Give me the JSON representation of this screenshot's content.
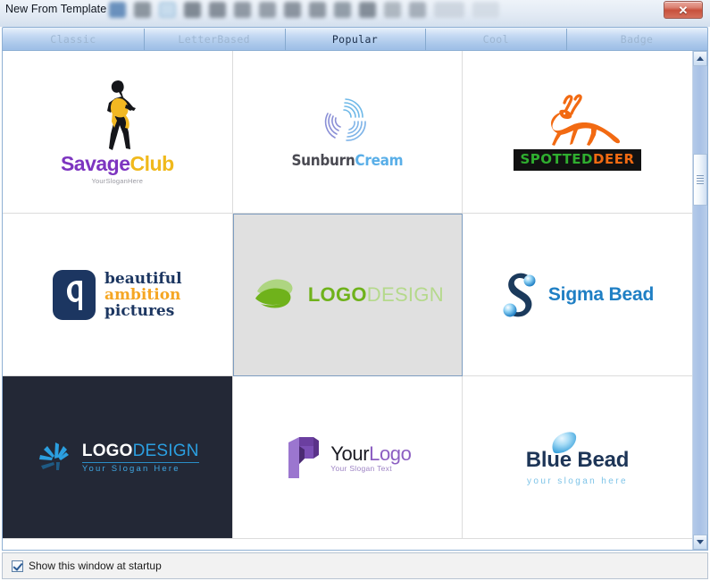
{
  "window": {
    "title": "New From Template",
    "close_label": "✕"
  },
  "tabs": [
    {
      "label": "Classic",
      "selected": false
    },
    {
      "label": "LetterBased",
      "selected": false
    },
    {
      "label": "Popular",
      "selected": true
    },
    {
      "label": "Cool",
      "selected": false
    },
    {
      "label": "Badge",
      "selected": false
    }
  ],
  "templates": [
    {
      "id": "savage-club",
      "name_part1": "Savage",
      "name_part2": "Club",
      "slogan": "YourSloganHere",
      "colors": {
        "part1": "#7d35c0",
        "part2": "#f0b91c",
        "slogan": "#9a9aa2"
      },
      "background": "#ffffff",
      "selected": false
    },
    {
      "id": "sunburn-cream",
      "name_part1": "Sunburn",
      "name_part2": "Cream",
      "slogan": "",
      "colors": {
        "part1": "#4a4a52",
        "part2": "#5aafe8"
      },
      "background": "#ffffff",
      "selected": false
    },
    {
      "id": "spotted-deer",
      "name_part1": "SPOTTED",
      "name_part2": "DEER",
      "slogan": "",
      "colors": {
        "part1": "#2fae2f",
        "part2": "#f26a12",
        "bar": "#111111"
      },
      "background": "#ffffff",
      "selected": false
    },
    {
      "id": "beautiful-ambition-pictures",
      "line1": "beautiful",
      "line2": "ambition",
      "line3": "pictures",
      "colors": {
        "line1": "#1c3661",
        "line2": "#f5a623",
        "line3": "#1c3661",
        "badge": "#1c3661"
      },
      "background": "#ffffff",
      "selected": false
    },
    {
      "id": "logo-design-leaf",
      "name_part1": "LOGO",
      "name_part2": "DESIGN",
      "slogan": "",
      "colors": {
        "part1": "#6fb21b",
        "part2": "#b5d98c",
        "leaf_dark": "#6fb21b",
        "leaf_light": "#aed581"
      },
      "background": "#e0e0e0",
      "selected": true
    },
    {
      "id": "sigma-bead",
      "name": "Sigma Bead",
      "colors": {
        "text": "#1f7fc4",
        "mark": "#1b3a5c"
      },
      "background": "#ffffff",
      "selected": false
    },
    {
      "id": "logo-design-dark",
      "name_part1": "LOGO",
      "name_part2": "DESIGN",
      "slogan": "Your Slogan Here",
      "colors": {
        "part1": "#ffffff",
        "part2": "#2b9fe0",
        "slogan": "#3fa7e3",
        "mark": "#2b9fe0"
      },
      "background": "#232836",
      "selected": false
    },
    {
      "id": "your-logo",
      "name_part1": "Your",
      "name_part2": "Logo",
      "slogan": "Your Slogan Text",
      "colors": {
        "part1": "#1a1a22",
        "part2": "#8c5fc2",
        "slogan": "#9d83c4",
        "mark": "#7b4fb5"
      },
      "background": "#ffffff",
      "selected": false
    },
    {
      "id": "blue-bead",
      "name": "Blue Bead",
      "slogan": "your slogan here",
      "colors": {
        "text": "#1d3557",
        "slogan": "#7ec4e8",
        "drop": "#59b6e8"
      },
      "background": "#ffffff",
      "selected": false
    }
  ],
  "scrollbar": {
    "up_arrow": "▲",
    "down_arrow": "▼"
  },
  "footer": {
    "checkbox_label": "Show this window at startup",
    "checked": true
  }
}
